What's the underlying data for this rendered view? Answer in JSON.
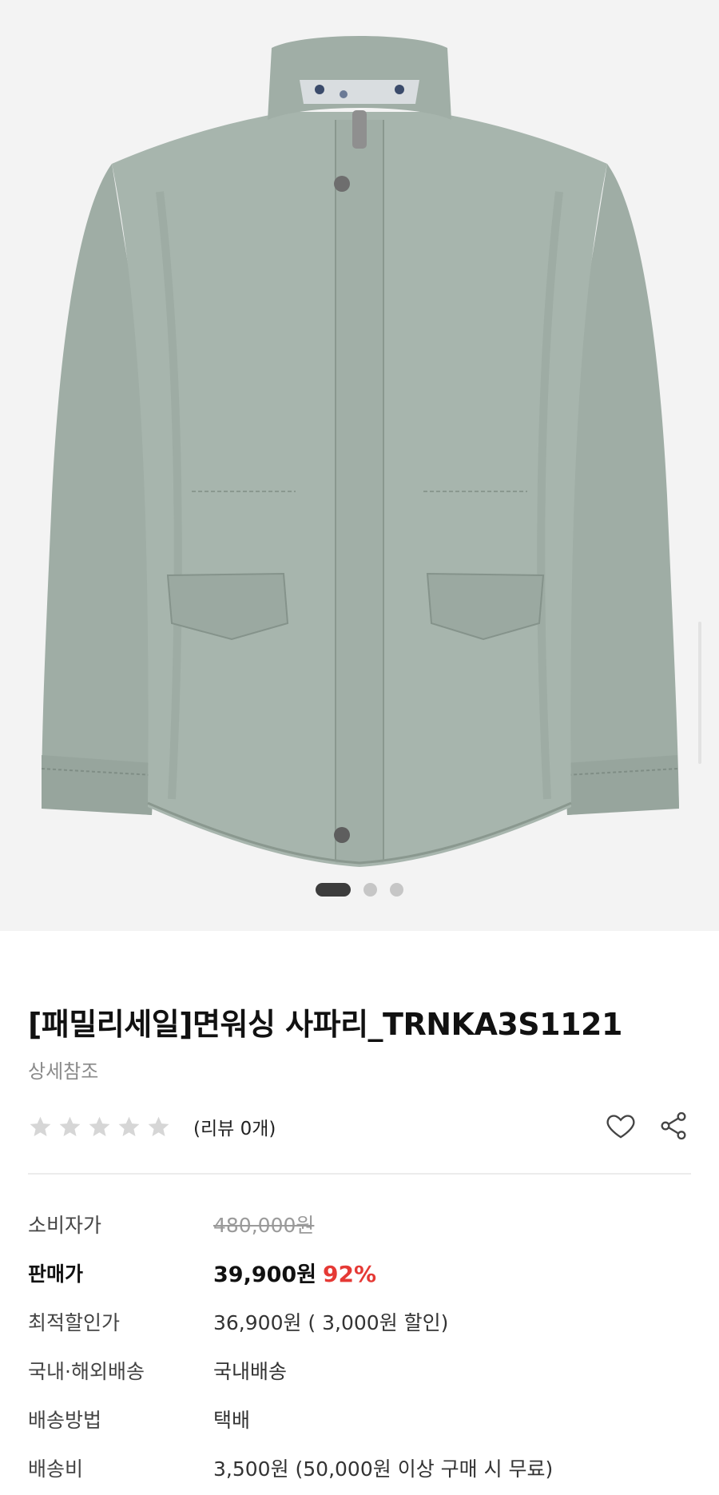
{
  "product": {
    "title": "[패밀리세일]면워싱 사파리_TRNKA3S1121",
    "subtitle": "상세참조",
    "rating_stars": 0,
    "review_count": "(리뷰 0개)",
    "image_alt": "sage green cotton safari jacket",
    "carousel": {
      "total": 3,
      "active": 1
    }
  },
  "actions": {
    "wishlist_icon": "heart-icon",
    "share_icon": "share-icon"
  },
  "price_rows": [
    {
      "key": "consumer",
      "label": "소비자가",
      "value": "480,000원"
    },
    {
      "key": "sale",
      "label": "판매가",
      "value": "39,900원",
      "badge": "92%"
    },
    {
      "key": "best",
      "label": "최적할인가",
      "value": "36,900원 ( 3,000원 할인)"
    },
    {
      "key": "ship_region",
      "label": "국내·해외배송",
      "value": "국내배송"
    },
    {
      "key": "ship_method",
      "label": "배송방법",
      "value": "택배"
    },
    {
      "key": "ship_fee",
      "label": "배송비",
      "value": "3,500원 (50,000원 이상 구매 시 무료)"
    }
  ],
  "colors": {
    "discount": "#e53935",
    "jacket": "#a3b2aa",
    "star": "#d6d6d6"
  }
}
